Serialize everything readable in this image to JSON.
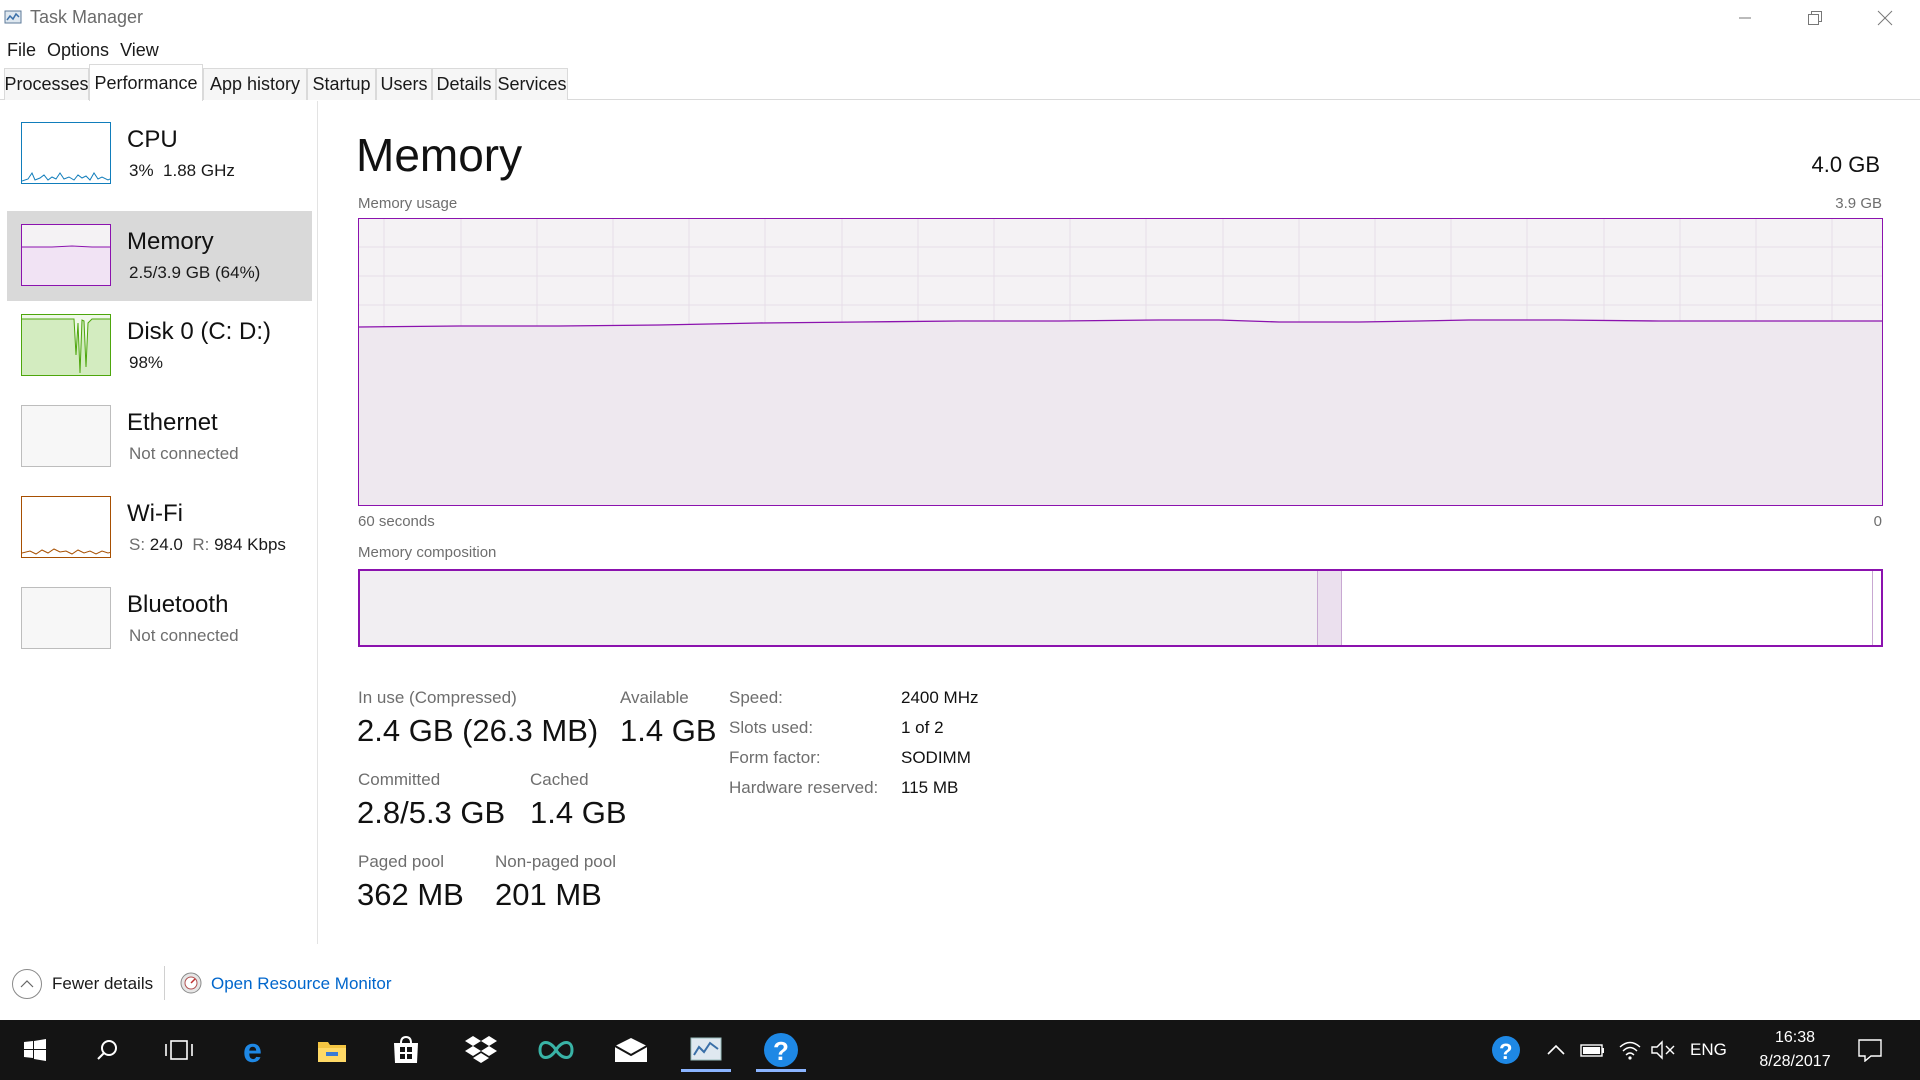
{
  "window": {
    "title": "Task Manager"
  },
  "menu": [
    "File",
    "Options",
    "View"
  ],
  "tabs": [
    "Processes",
    "Performance",
    "App history",
    "Startup",
    "Users",
    "Details",
    "Services"
  ],
  "active_tab": "Performance",
  "sidebar": [
    {
      "title": "CPU",
      "sub1": "3%",
      "sub2": "1.88 GHz",
      "color": "#117dbb"
    },
    {
      "title": "Memory",
      "sub1": "2.5/3.9 GB (64%)",
      "color": "#8b12ae"
    },
    {
      "title": "Disk 0 (C: D:)",
      "sub1": "98%",
      "color": "#4da60c"
    },
    {
      "title": "Ethernet",
      "sub1": "Not connected",
      "color": "#a0a0a0"
    },
    {
      "title": "Wi-Fi",
      "s_label": "S:",
      "s_value": "24.0",
      "r_label": "R:",
      "r_value": "984 Kbps",
      "color": "#a74f01"
    },
    {
      "title": "Bluetooth",
      "sub1": "Not connected",
      "color": "#a0a0a0"
    }
  ],
  "main": {
    "title": "Memory",
    "total": "4.0 GB",
    "usage_label": "Memory usage",
    "usage_max": "3.9 GB",
    "time_left": "60 seconds",
    "time_right": "0",
    "composition_label": "Memory composition",
    "usage_fraction": 0.64,
    "composition": {
      "in_use_fraction": 0.628,
      "modified_fraction": 0.016,
      "standby_fraction": 0.348
    }
  },
  "stats": {
    "in_use_label": "In use (Compressed)",
    "in_use_value": "2.4 GB (26.3 MB)",
    "available_label": "Available",
    "available_value": "1.4 GB",
    "committed_label": "Committed",
    "committed_value": "2.8/5.3 GB",
    "cached_label": "Cached",
    "cached_value": "1.4 GB",
    "paged_label": "Paged pool",
    "paged_value": "362 MB",
    "nonpaged_label": "Non-paged pool",
    "nonpaged_value": "201 MB"
  },
  "specs": {
    "speed_label": "Speed:",
    "speed_value": "2400 MHz",
    "slots_label": "Slots used:",
    "slots_value": "1 of 2",
    "form_label": "Form factor:",
    "form_value": "SODIMM",
    "hw_label": "Hardware reserved:",
    "hw_value": "115 MB"
  },
  "footer": {
    "fewer_details": "Fewer details",
    "open_resmon": "Open Resource Monitor"
  },
  "taskbar": {
    "apps": [
      "start-icon",
      "search-icon",
      "task-view-icon",
      "edge-icon",
      "file-explorer-icon",
      "store-icon",
      "dropbox-icon",
      "arduino-icon",
      "mail-icon",
      "task-manager-icon",
      "help-icon"
    ],
    "lang": "ENG",
    "time": "16:38",
    "date": "8/28/2017"
  }
}
